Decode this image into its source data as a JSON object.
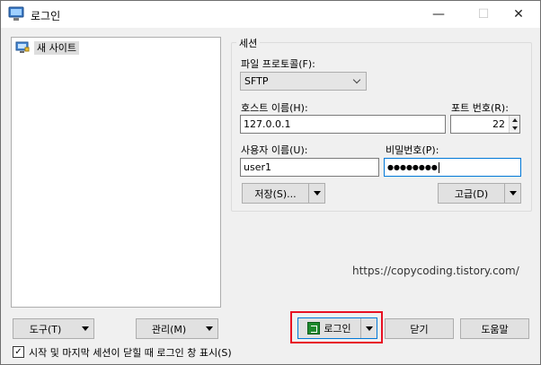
{
  "window": {
    "title": "로그인",
    "minimize_glyph": "—",
    "maximize_glyph": "☐",
    "close_glyph": "✕"
  },
  "site_tree": {
    "items": [
      {
        "label": "새 사이트",
        "icon": "computer-site-icon"
      }
    ]
  },
  "session": {
    "group_title": "세션",
    "protocol_label": "파일 프로토콜(F):",
    "protocol_value": "SFTP",
    "host_label": "호스트 이름(H):",
    "host_value": "127.0.0.1",
    "port_label": "포트 번호(R):",
    "port_value": "22",
    "username_label": "사용자 이름(U):",
    "username_value": "user1",
    "password_label": "비밀번호(P):",
    "password_value": "●●●●●●●●",
    "save_label": "저장(S)...",
    "advanced_label": "고급(D)"
  },
  "watermark": "https://copycoding.tistory.com/",
  "bottom": {
    "tools_label": "도구(T)",
    "manage_label": "관리(M)",
    "login_label": "로그인",
    "close_label": "닫기",
    "help_label": "도움말",
    "startup_check_label": "시작 및 마지막 세션이 닫힐 때 로그인 창 표시(S)",
    "startup_check_checked": true
  },
  "colors": {
    "accent_focus": "#0078d7",
    "highlight_box": "#e81123",
    "login_icon": "#1e8a2e"
  }
}
